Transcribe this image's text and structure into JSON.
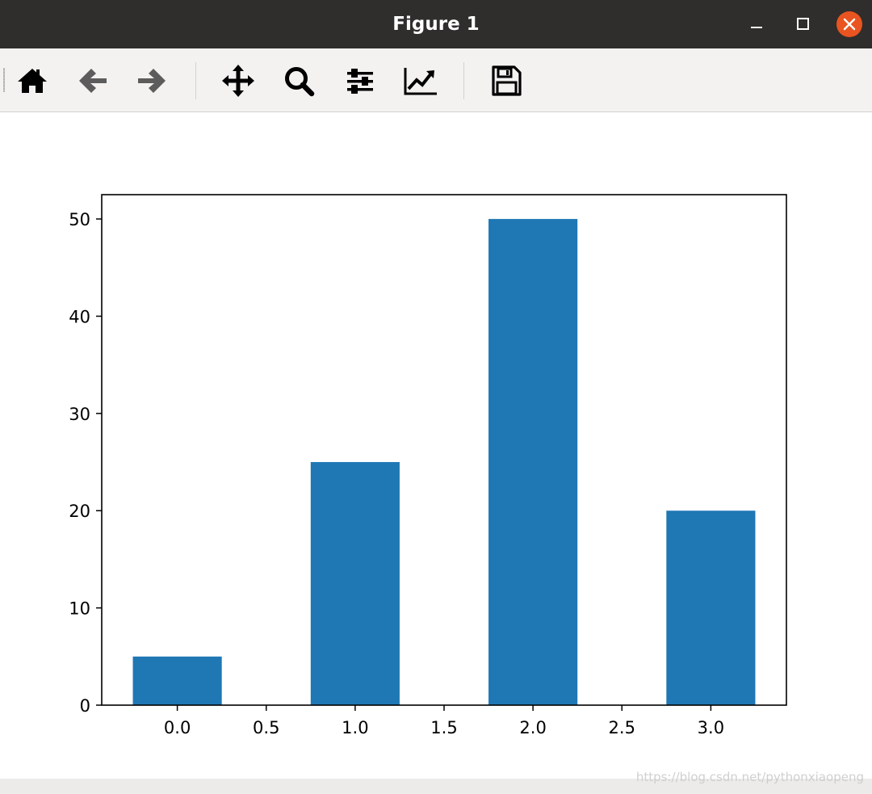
{
  "window": {
    "title": "Figure 1",
    "close_button_color": "#e95420",
    "titlebar_color": "#2f2e2c"
  },
  "toolbar": {
    "buttons": [
      {
        "name": "home",
        "icon": "home-icon",
        "enabled": true
      },
      {
        "name": "back",
        "icon": "arrow-left-icon",
        "enabled": false
      },
      {
        "name": "forward",
        "icon": "arrow-right-icon",
        "enabled": false
      },
      {
        "name": "pan",
        "icon": "move-icon",
        "enabled": true
      },
      {
        "name": "zoom",
        "icon": "magnifier-icon",
        "enabled": true
      },
      {
        "name": "configure-subplots",
        "icon": "sliders-icon",
        "enabled": true
      },
      {
        "name": "edit-axis",
        "icon": "line-chart-icon",
        "enabled": true
      },
      {
        "name": "save",
        "icon": "floppy-disk-icon",
        "enabled": true
      }
    ]
  },
  "chart_data": {
    "type": "bar",
    "x": [
      0,
      1,
      2,
      3
    ],
    "values": [
      5,
      25,
      50,
      20
    ],
    "bar_width": 0.5,
    "xlim": [
      -0.425,
      3.425
    ],
    "ylim": [
      0,
      52.5
    ],
    "xticks": [
      0.0,
      0.5,
      1.0,
      1.5,
      2.0,
      2.5,
      3.0
    ],
    "xtick_labels": [
      "0.0",
      "0.5",
      "1.0",
      "1.5",
      "2.0",
      "2.5",
      "3.0"
    ],
    "yticks": [
      0,
      10,
      20,
      30,
      40,
      50
    ],
    "ytick_labels": [
      "0",
      "10",
      "20",
      "30",
      "40",
      "50"
    ],
    "bar_color": "#1f77b4",
    "title": "",
    "xlabel": "",
    "ylabel": "",
    "grid": false
  },
  "watermark": "https://blog.csdn.net/pythonxiaopeng"
}
